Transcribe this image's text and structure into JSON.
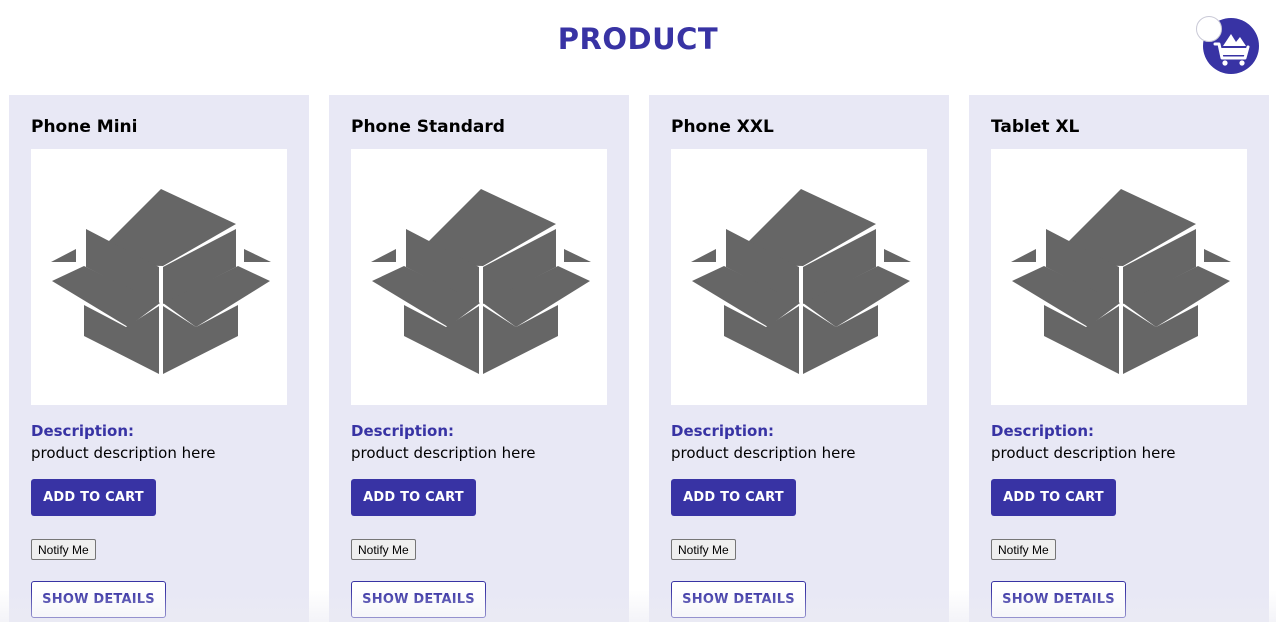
{
  "header": {
    "title": "PRODUCT",
    "cart_icon": "shopping-cart-icon",
    "cart_badge": ""
  },
  "colors": {
    "brand": "#3833a4",
    "card_background": "#e8e8f5",
    "icon_gray": "#666666"
  },
  "products": [
    {
      "name": "Phone Mini",
      "image_icon": "open-box-icon",
      "description_label": "Description:",
      "description": "product description here",
      "add_to_cart_label": "ADD TO CART",
      "notify_label": "Notify Me",
      "show_details_label": "SHOW DETAILS"
    },
    {
      "name": "Phone Standard",
      "image_icon": "open-box-icon",
      "description_label": "Description:",
      "description": "product description here",
      "add_to_cart_label": "ADD TO CART",
      "notify_label": "Notify Me",
      "show_details_label": "SHOW DETAILS"
    },
    {
      "name": "Phone XXL",
      "image_icon": "open-box-icon",
      "description_label": "Description:",
      "description": "product description here",
      "add_to_cart_label": "ADD TO CART",
      "notify_label": "Notify Me",
      "show_details_label": "SHOW DETAILS"
    },
    {
      "name": "Tablet XL",
      "image_icon": "open-box-icon",
      "description_label": "Description:",
      "description": "product description here",
      "add_to_cart_label": "ADD TO CART",
      "notify_label": "Notify Me",
      "show_details_label": "SHOW DETAILS"
    }
  ]
}
